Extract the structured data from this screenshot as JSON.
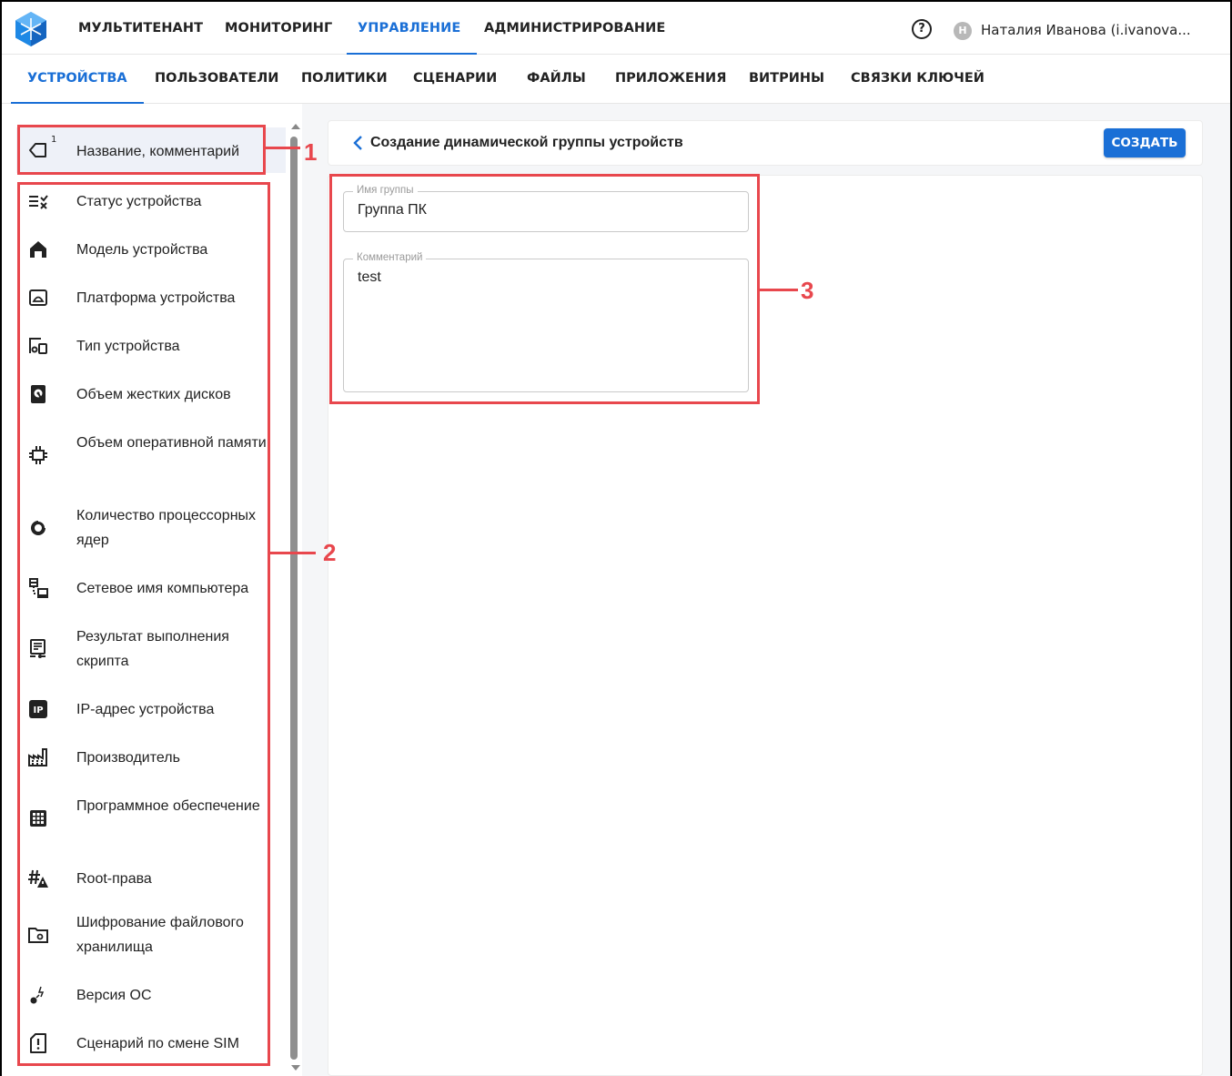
{
  "top_nav": {
    "items": [
      "МУЛЬТИТЕНАНТ",
      "МОНИТОРИНГ",
      "УПРАВЛЕНИЕ",
      "АДМИНИСТРИРОВАНИЕ"
    ],
    "active_index": 2,
    "help_glyph": "?",
    "avatar_initial": "Н",
    "user_name": "Наталия Иванова (i.ivanova..."
  },
  "sub_nav": {
    "tabs": [
      "УСТРОЙСТВА",
      "ПОЛЬЗОВАТЕЛИ",
      "ПОЛИТИКИ",
      "СЦЕНАРИИ",
      "ФАЙЛЫ",
      "ПРИЛОЖЕНИЯ",
      "ВИТРИНЫ",
      "СВЯЗКИ КЛЮЧЕЙ"
    ],
    "active_index": 0
  },
  "sidebar": {
    "name_item": {
      "label": "Название, комментарий",
      "badge": "1",
      "icon": "tag-icon"
    },
    "criteria": [
      {
        "label": "Статус устройства",
        "icon": "list-status-icon"
      },
      {
        "label": "Модель устройства",
        "icon": "home-icon"
      },
      {
        "label": "Платформа устройства",
        "icon": "platform-icon"
      },
      {
        "label": "Тип устройства",
        "icon": "device-type-icon"
      },
      {
        "label": "Объем жестких дисков",
        "icon": "hdd-icon"
      },
      {
        "label": "Объем оперативной памяти",
        "icon": "ram-icon"
      },
      {
        "label": "Количество процессорных ядер",
        "icon": "cpu-icon"
      },
      {
        "label": "Сетевое имя компьютера",
        "icon": "network-icon"
      },
      {
        "label": "Результат выполнения скрипта",
        "icon": "script-icon"
      },
      {
        "label": "IP-адрес устройства",
        "icon": "ip-icon"
      },
      {
        "label": "Производитель",
        "icon": "factory-icon"
      },
      {
        "label": "Программное обеспечение",
        "icon": "apps-grid-icon"
      },
      {
        "label": "Root-права",
        "icon": "root-icon"
      },
      {
        "label": "Шифрование файлового хранилища",
        "icon": "folder-lock-icon"
      },
      {
        "label": "Версия ОС",
        "icon": "os-version-icon"
      },
      {
        "label": "Сценарий по смене SIM",
        "icon": "sim-icon"
      }
    ]
  },
  "main": {
    "title": "Создание динамической группы устройств",
    "create_label": "СОЗДАТЬ",
    "group_name": {
      "legend": "Имя группы",
      "value": "Группа ПК"
    },
    "comment": {
      "legend": "Комментарий",
      "value": "test"
    }
  },
  "annotations": {
    "n1": "1",
    "n2": "2",
    "n3": "3",
    "color": "#e8474d"
  },
  "colors": {
    "accent": "#1a6fd6",
    "text": "#222222",
    "highlight": "#eef1f8"
  }
}
